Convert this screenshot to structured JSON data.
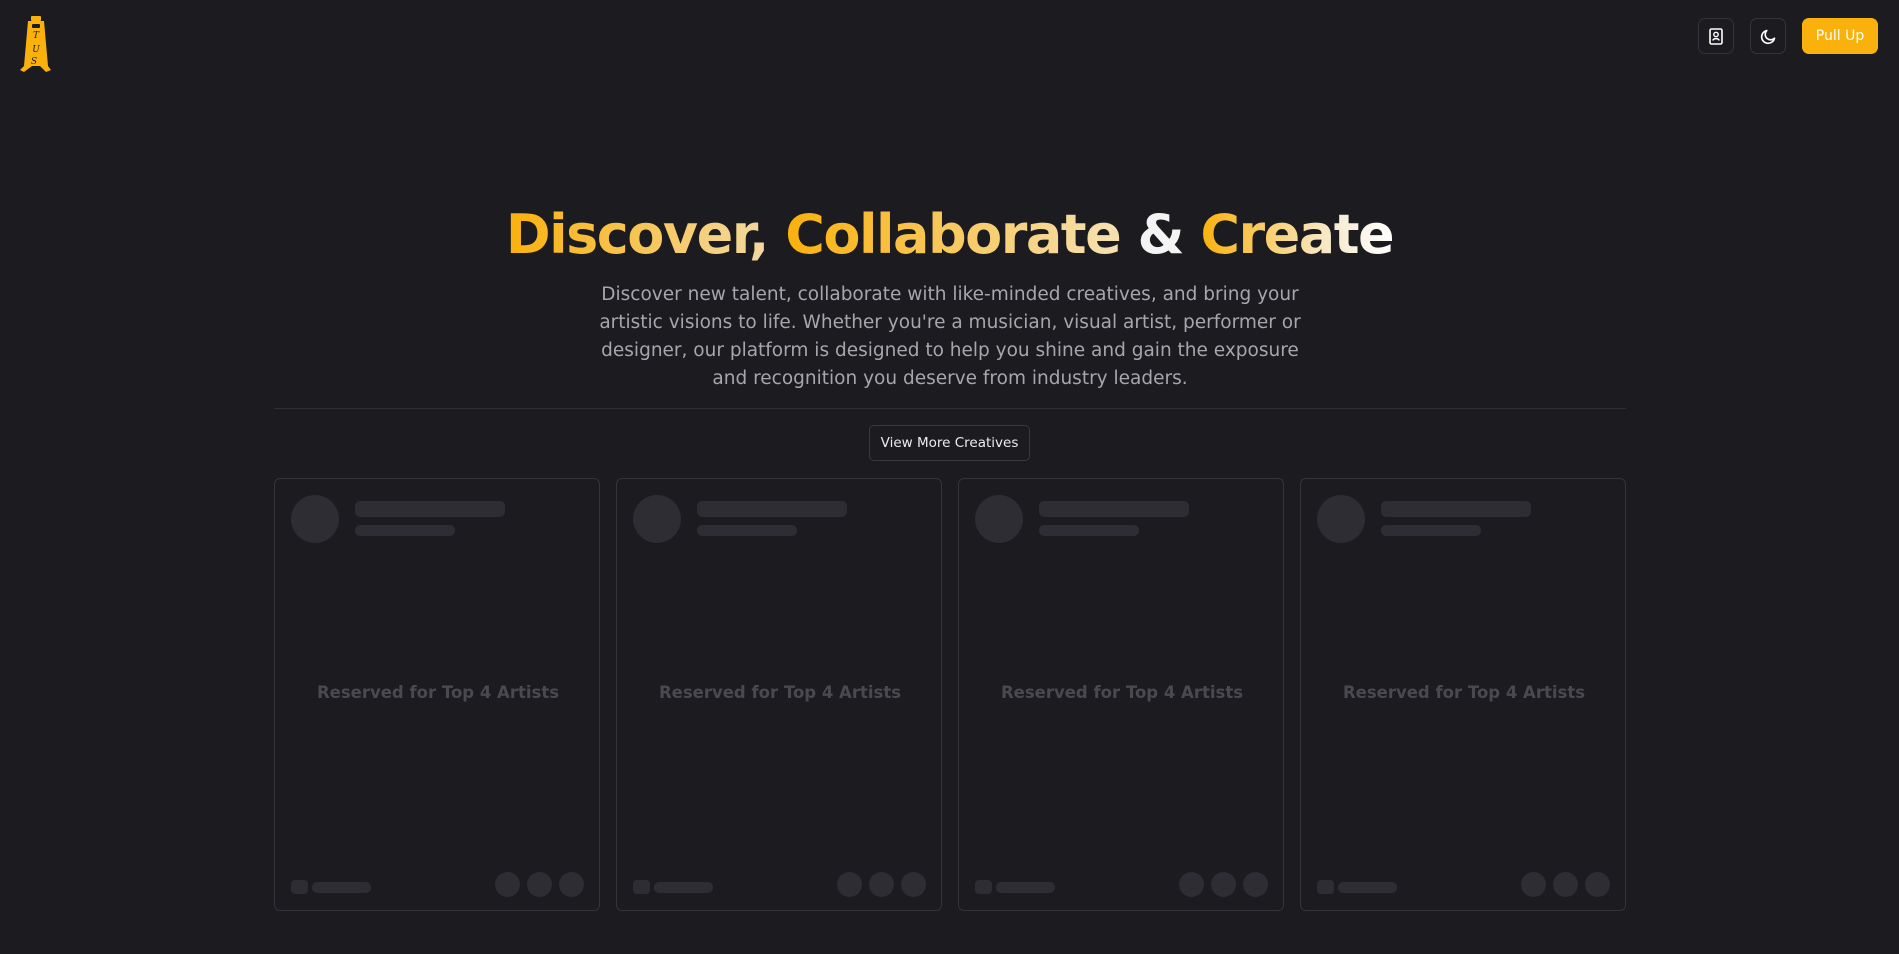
{
  "header": {
    "logo_letters": [
      "T",
      "U",
      "S"
    ],
    "contacts_icon": "contact-book-icon",
    "theme_icon": "moon-icon",
    "pull_up_label": "Pull Up"
  },
  "hero": {
    "title_part1": "Discover,",
    "title_part2": "Collaborate",
    "title_part3": "&",
    "title_part4": "Create",
    "description": "Discover new talent, collaborate with like-minded creatives, and bring your artistic visions to life. Whether you're a musician, visual artist, performer or designer, our platform is designed to help you shine and gain the exposure and recognition you deserve from industry leaders."
  },
  "view_more_label": "View More Creatives",
  "cards": [
    {
      "label": "Reserved for Top 4 Artists"
    },
    {
      "label": "Reserved for Top 4 Artists"
    },
    {
      "label": "Reserved for Top 4 Artists"
    },
    {
      "label": "Reserved for Top 4 Artists"
    }
  ],
  "colors": {
    "background": "#1c1b20",
    "accent": "#fbb10b",
    "skeleton": "#2e2d33",
    "border": "#34333a"
  }
}
